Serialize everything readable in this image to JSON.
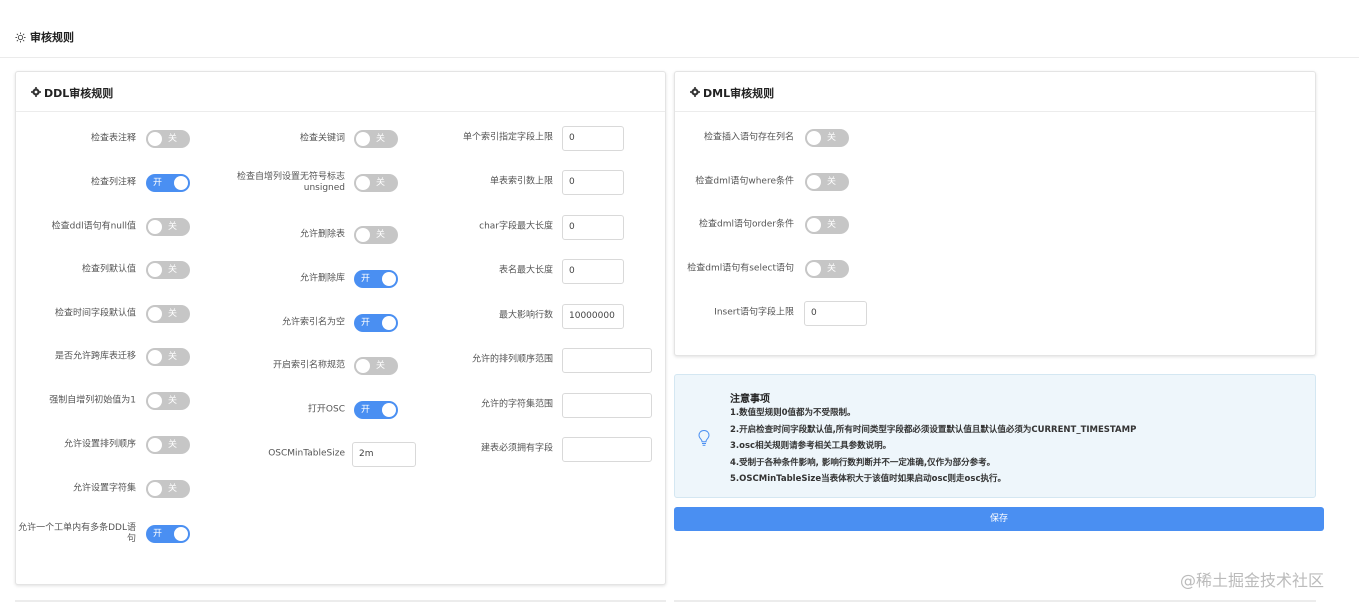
{
  "page": {
    "title": "审核规则"
  },
  "ddl": {
    "title": "DDL审核规则",
    "col1": [
      {
        "label": "检查表注释",
        "state": "关",
        "on": false
      },
      {
        "label": "检查列注释",
        "state": "开",
        "on": true
      },
      {
        "label": "检查ddl语句有null值",
        "state": "关",
        "on": false
      },
      {
        "label": "检查列默认值",
        "state": "关",
        "on": false
      },
      {
        "label": "检查时间字段默认值",
        "state": "关",
        "on": false
      },
      {
        "label": "是否允许跨库表迁移",
        "state": "关",
        "on": false
      },
      {
        "label": "强制自增列初始值为1",
        "state": "关",
        "on": false
      },
      {
        "label": "允许设置排列顺序",
        "state": "关",
        "on": false
      },
      {
        "label": "允许设置字符集",
        "state": "关",
        "on": false
      },
      {
        "label": "允许一个工单内有多条DDL语句",
        "state": "开",
        "on": true
      }
    ],
    "col2": [
      {
        "label": "检查关键词",
        "state": "关",
        "on": false
      },
      {
        "label": "检查自增列设置无符号标志unsigned",
        "state": "关",
        "on": false
      },
      {
        "label": "允许删除表",
        "state": "关",
        "on": false
      },
      {
        "label": "允许删除库",
        "state": "开",
        "on": true
      },
      {
        "label": "允许索引名为空",
        "state": "开",
        "on": true
      },
      {
        "label": "开启索引名称规范",
        "state": "关",
        "on": false
      },
      {
        "label": "打开OSC",
        "state": "开",
        "on": true
      }
    ],
    "col2_input": {
      "label": "OSCMinTableSize",
      "value": "2m"
    },
    "col3": [
      {
        "label": "单个索引指定字段上限",
        "value": "0"
      },
      {
        "label": "单表索引数上限",
        "value": "0"
      },
      {
        "label": "char字段最大长度",
        "value": "0"
      },
      {
        "label": "表名最大长度",
        "value": "0"
      },
      {
        "label": "最大影响行数",
        "value": "10000000"
      },
      {
        "label": "允许的排列顺序范围",
        "value": ""
      },
      {
        "label": "允许的字符集范围",
        "value": ""
      },
      {
        "label": "建表必须拥有字段",
        "value": ""
      }
    ]
  },
  "dml": {
    "title": "DML审核规则",
    "switches": [
      {
        "label": "检查插入语句存在列名",
        "state": "关",
        "on": false
      },
      {
        "label": "检查dml语句where条件",
        "state": "关",
        "on": false
      },
      {
        "label": "检查dml语句order条件",
        "state": "关",
        "on": false
      },
      {
        "label": "检查dml语句有select语句",
        "state": "关",
        "on": false
      }
    ],
    "input": {
      "label": "Insert语句字段上限",
      "value": "0"
    }
  },
  "notice": {
    "title": "注意事项",
    "items": [
      "1.数值型规则0值都为不受限制。",
      "2.开启检查时间字段默认值,所有时间类型字段都必须设置默认值且默认值必须为CURRENT_TIMESTAMP",
      "3.osc相关规则请参考相关工具参数说明。",
      "4.受制于各种条件影响, 影响行数判断并不一定准确,仅作为部分参考。",
      "5.OSCMinTableSize当表体积大于该值时如果启动osc则走osc执行。"
    ]
  },
  "save_label": "保存",
  "watermark": "@稀土掘金技术社区",
  "colors": {
    "accent": "#4a8ff2",
    "switch_off": "#c6c6c6",
    "notice_bg": "#eef6fb"
  }
}
